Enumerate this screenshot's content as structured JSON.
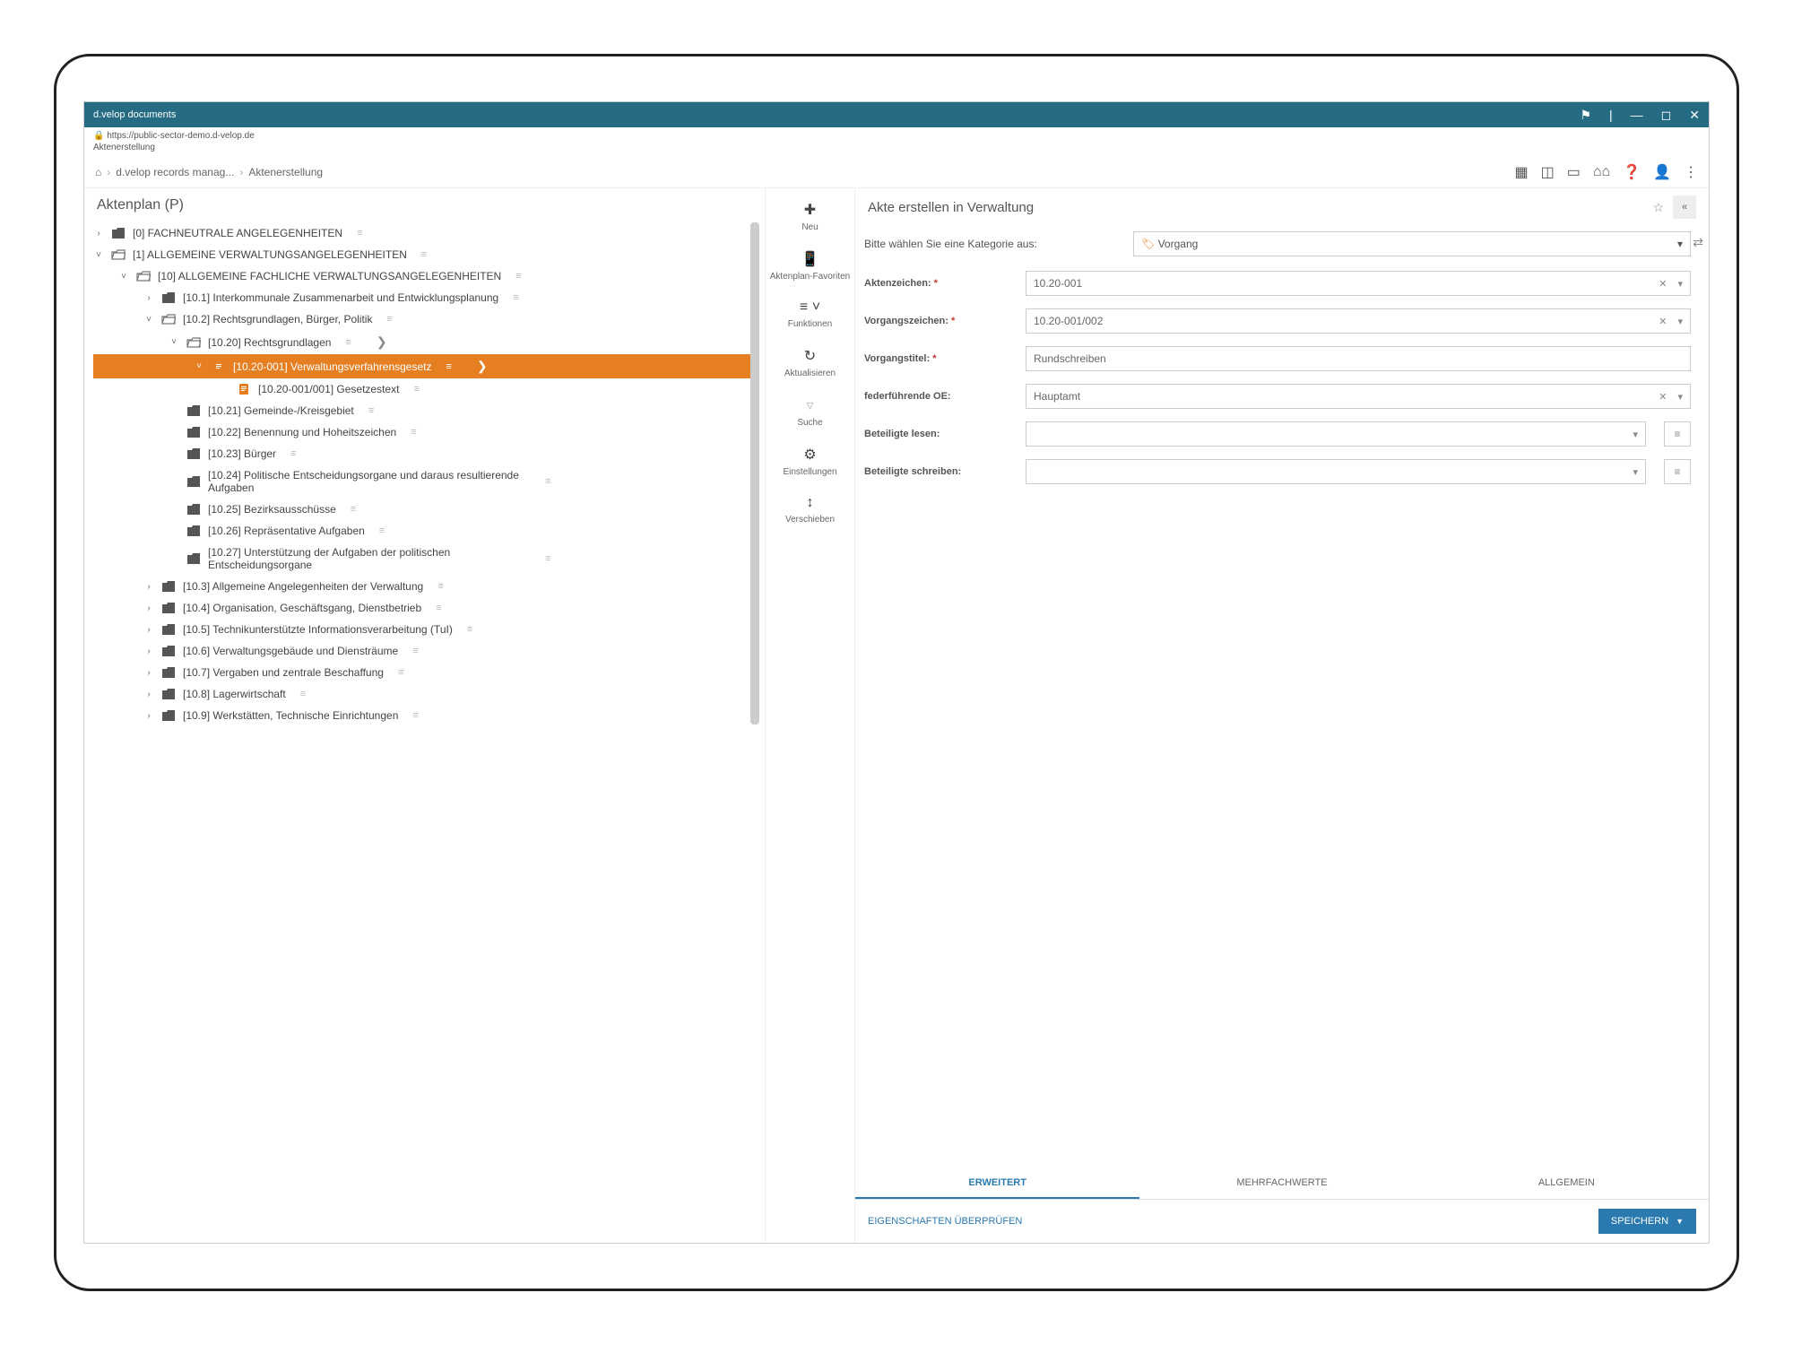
{
  "titlebar": {
    "title": "d.velop documents"
  },
  "urlbar": {
    "url": "https://public-sector-demo.d-velop.de",
    "sub": "Aktenerstellung"
  },
  "breadcrumb": {
    "home": "⌂",
    "mid": "d.velop records manag...",
    "last": "Aktenerstellung"
  },
  "leftPanel": {
    "title": "Aktenplan (P)"
  },
  "tree": [
    {
      "indent": 0,
      "expand": "›",
      "iconType": "folder",
      "label": "[0] FACHNEUTRALE ANGELEGENHEITEN",
      "handle": true
    },
    {
      "indent": 0,
      "expand": "˅",
      "iconType": "folder-open",
      "label": "[1] ALLGEMEINE VERWALTUNGSANGELEGENHEITEN",
      "handle": true
    },
    {
      "indent": 1,
      "expand": "˅",
      "iconType": "folder-open",
      "label": "[10] ALLGEMEINE FACHLICHE VERWALTUNGSANGELEGENHEITEN",
      "handle": true
    },
    {
      "indent": 2,
      "expand": "›",
      "iconType": "folder",
      "label": "[10.1] Interkommunale Zusammenarbeit und Entwicklungsplanung",
      "handle": true
    },
    {
      "indent": 2,
      "expand": "˅",
      "iconType": "folder-open",
      "label": "[10.2] Rechtsgrundlagen, Bürger, Politik",
      "handle": true
    },
    {
      "indent": 3,
      "expand": "˅",
      "iconType": "folder-open",
      "label": "[10.20] Rechtsgrundlagen",
      "handle": true,
      "chevRight": true
    },
    {
      "indent": 4,
      "expand": "˅",
      "iconType": "file",
      "label": "[10.20-001] Verwaltungsverfahrensgesetz",
      "handle": true,
      "selected": true,
      "chevRight": true
    },
    {
      "indent": 5,
      "expand": "",
      "iconType": "file",
      "label": "[10.20-001/001] Gesetzestext",
      "handle": true
    },
    {
      "indent": 3,
      "expand": "",
      "iconType": "folder",
      "label": "[10.21] Gemeinde-/Kreisgebiet",
      "handle": true
    },
    {
      "indent": 3,
      "expand": "",
      "iconType": "folder",
      "label": "[10.22] Benennung und Hoheitszeichen",
      "handle": true
    },
    {
      "indent": 3,
      "expand": "",
      "iconType": "folder",
      "label": "[10.23] Bürger",
      "handle": true
    },
    {
      "indent": 3,
      "expand": "",
      "iconType": "folder",
      "label": "[10.24] Politische Entscheidungsorgane und daraus resultierende Aufgaben",
      "handle": true,
      "wrap": true
    },
    {
      "indent": 3,
      "expand": "",
      "iconType": "folder",
      "label": "[10.25] Bezirksausschüsse",
      "handle": true
    },
    {
      "indent": 3,
      "expand": "",
      "iconType": "folder",
      "label": "[10.26] Repräsentative Aufgaben",
      "handle": true
    },
    {
      "indent": 3,
      "expand": "",
      "iconType": "folder",
      "label": "[10.27] Unterstützung der Aufgaben der politischen Entscheidungsorgane",
      "handle": true,
      "wrap": true
    },
    {
      "indent": 2,
      "expand": "›",
      "iconType": "folder",
      "label": "[10.3] Allgemeine Angelegenheiten der Verwaltung",
      "handle": true
    },
    {
      "indent": 2,
      "expand": "›",
      "iconType": "folder",
      "label": "[10.4] Organisation, Geschäftsgang, Dienstbetrieb",
      "handle": true
    },
    {
      "indent": 2,
      "expand": "›",
      "iconType": "folder",
      "label": "[10.5] Technikunterstützte Informationsverarbeitung (TuI)",
      "handle": true
    },
    {
      "indent": 2,
      "expand": "›",
      "iconType": "folder",
      "label": "[10.6] Verwaltungsgebäude und Diensträume",
      "handle": true
    },
    {
      "indent": 2,
      "expand": "›",
      "iconType": "folder",
      "label": "[10.7] Vergaben und zentrale Beschaffung",
      "handle": true
    },
    {
      "indent": 2,
      "expand": "›",
      "iconType": "folder",
      "label": "[10.8] Lagerwirtschaft",
      "handle": true
    },
    {
      "indent": 2,
      "expand": "›",
      "iconType": "folder",
      "label": "[10.9] Werkstätten, Technische Einrichtungen",
      "handle": true
    }
  ],
  "midToolbar": [
    {
      "icon": "✚",
      "iconClass": "",
      "label": "Neu"
    },
    {
      "icon": "📱",
      "iconClass": "",
      "label": "Aktenplan-Favoriten"
    },
    {
      "icon": "≡ ˅",
      "iconClass": "",
      "label": "Funktionen"
    },
    {
      "icon": "↻",
      "iconClass": "",
      "label": "Aktualisieren"
    },
    {
      "icon": "▿",
      "iconClass": "muted",
      "label": "Suche"
    },
    {
      "icon": "⚙",
      "iconClass": "",
      "label": "Einstellungen"
    },
    {
      "icon": "↕",
      "iconClass": "",
      "label": "Verschieben"
    }
  ],
  "rightPanel": {
    "title": "Akte erstellen in Verwaltung",
    "prompt": "Bitte wählen Sie eine Kategorie aus:",
    "category": "Vorgang",
    "fields": [
      {
        "label": "Aktenzeichen:",
        "required": true,
        "value": "10.20-001",
        "clear": true,
        "dropdown": true
      },
      {
        "label": "Vorgangszeichen:",
        "required": true,
        "value": "10.20-001/002",
        "clear": true,
        "dropdown": true
      },
      {
        "label": "Vorgangstitel:",
        "required": true,
        "value": "Rundschreiben"
      },
      {
        "label": "federführende OE:",
        "required": false,
        "value": "Hauptamt",
        "clear": true,
        "dropdown": true
      },
      {
        "label": "Beteiligte lesen:",
        "required": false,
        "value": "",
        "dropdown": true,
        "extra": true
      },
      {
        "label": "Beteiligte schreiben:",
        "required": false,
        "value": "",
        "dropdown": true,
        "extra": true
      }
    ],
    "tabs": [
      {
        "label": "ERWEITERT",
        "active": true
      },
      {
        "label": "MEHRFACHWERTE",
        "active": false
      },
      {
        "label": "ALLGEMEIN",
        "active": false
      }
    ],
    "linkAction": "EIGENSCHAFTEN ÜBERPRÜFEN",
    "saveLabel": "SPEICHERN"
  }
}
